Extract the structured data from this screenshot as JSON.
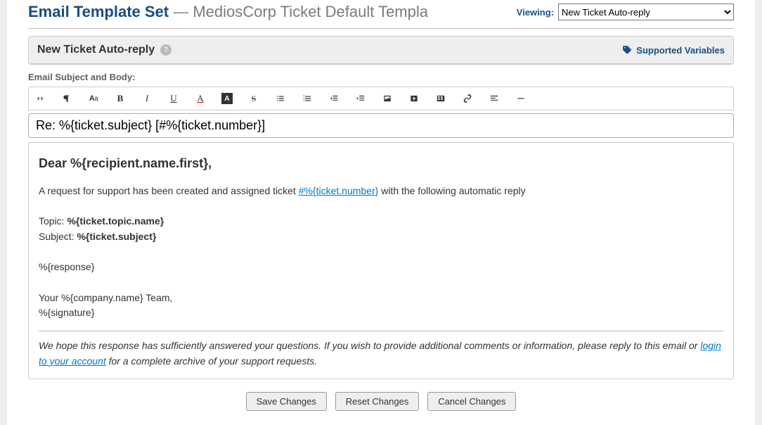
{
  "header": {
    "title_link": "Email Template Set",
    "dash": "—",
    "subtitle": "MediosCorp Ticket Default Templa"
  },
  "viewing": {
    "label": "Viewing:",
    "selected": "New Ticket Auto-reply"
  },
  "panel": {
    "title": "New Ticket Auto-reply",
    "supported_vars": "Supported Variables"
  },
  "section_label": "Email Subject and Body:",
  "subject_value": "Re: %{ticket.subject} [#%{ticket.number}]",
  "body": {
    "greeting": "Dear %{recipient.name.first},",
    "line1_a": "A request for support has been created and assigned ticket ",
    "line1_link": "#%{ticket.number}",
    "line1_b": " with the following automatic reply",
    "topic_label": "Topic: ",
    "topic_value": "%{ticket.topic.name}",
    "subject_label": "Subject: ",
    "subject_value": "%{ticket.subject}",
    "response": "%{response}",
    "sign_line1": "Your %{company.name} Team,",
    "sign_line2": "%{signature}",
    "footer_a": "We hope this response has sufficiently answered your questions. If you wish to provide additional comments or information, please reply to this email or ",
    "footer_link": "login to your account",
    "footer_b": " for a complete archive of your support requests."
  },
  "buttons": {
    "save": "Save Changes",
    "reset": "Reset Changes",
    "cancel": "Cancel Changes"
  }
}
